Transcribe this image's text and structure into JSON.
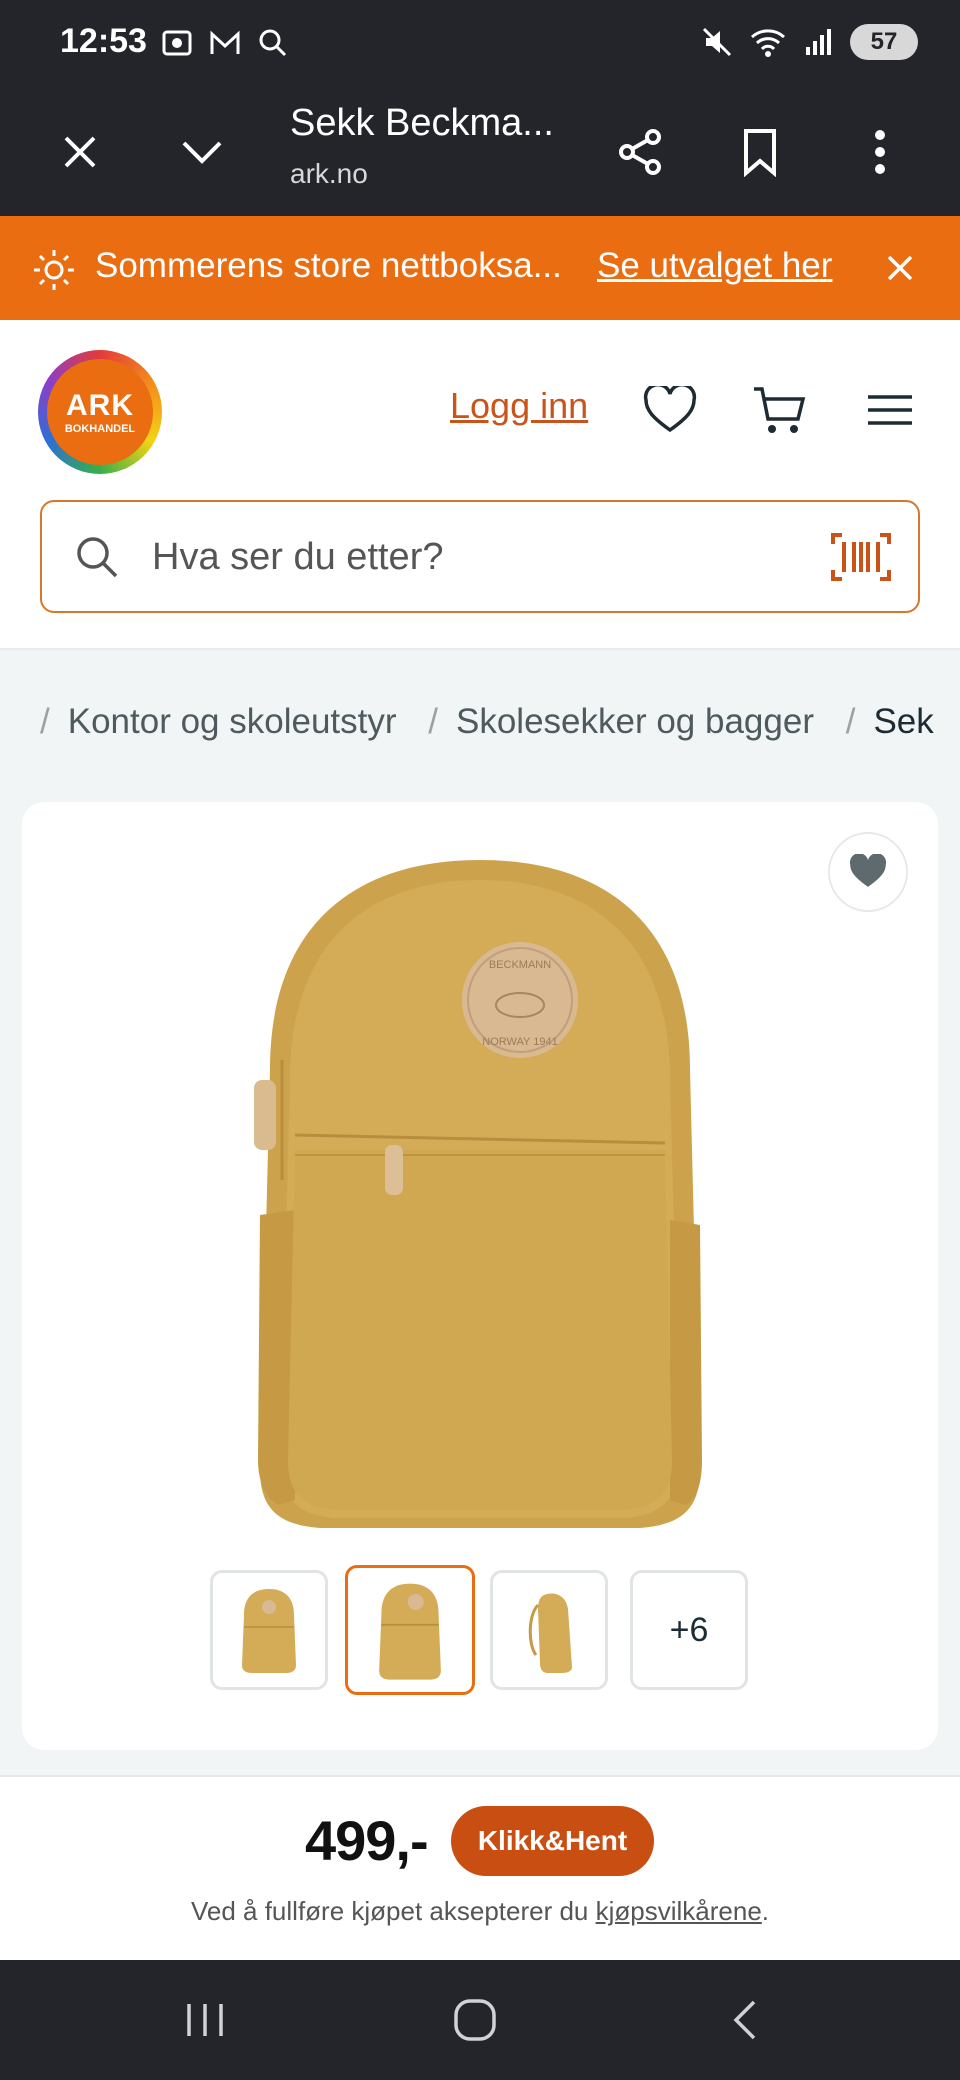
{
  "status_bar": {
    "time": "12:53",
    "battery": "57"
  },
  "browser": {
    "title": "Sekk Beckma...",
    "url": "ark.no"
  },
  "banner": {
    "text": "Sommerens store nettboksa...",
    "link": "Se utvalget her"
  },
  "header": {
    "logo_text": "ARK",
    "logo_sub": "BOKHANDEL",
    "login": "Logg inn"
  },
  "search": {
    "placeholder": "Hva ser du etter?"
  },
  "breadcrumb": {
    "items": [
      "Kontor og skoleutstyr",
      "Skolesekker og bagger",
      "Sek"
    ]
  },
  "product": {
    "thumbnails_more": "+6",
    "price": "499,-",
    "button": "Klikk&Hent",
    "terms_prefix": "Ved å fullføre kjøpet aksepterer du ",
    "terms_link": "kjøpsvilkårene",
    "terms_suffix": ".",
    "patch_text_top": "BECKMANN",
    "patch_text_bottom": "NORWAY 1941"
  },
  "colors": {
    "accent": "#ea6d12",
    "button": "#c84e12",
    "backpack": "#d4ac57"
  }
}
